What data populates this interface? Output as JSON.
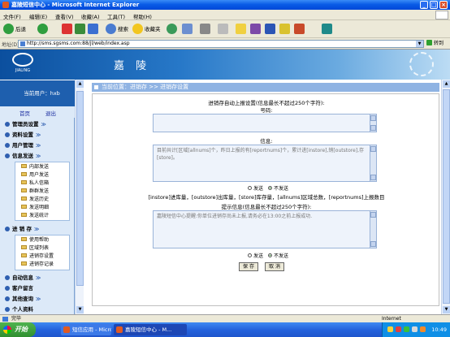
{
  "window": {
    "title": "嘉陵短信中心 - Microsoft Internet Explorer",
    "buttons": [
      "_",
      "□",
      "×"
    ]
  },
  "menubar": [
    "文件(F)",
    "编辑(E)",
    "查看(V)",
    "收藏(A)",
    "工具(T)",
    "帮助(H)"
  ],
  "toolbar": {
    "back_label": "后退",
    "search_label": "搜索",
    "favorites_label": "收藏夹"
  },
  "address": {
    "label": "地址(D)",
    "url": "http://sms.sgsms.com:88/jl/web/index.asp",
    "go_label": "转到"
  },
  "banner": {
    "logo_text": "JIALING",
    "title": "嘉 陵"
  },
  "sidebar": {
    "current_user": "当前用户：hxb",
    "home_link": "首页",
    "logout_link": "退出",
    "menu": [
      {
        "label": "管理员设置",
        "arrow": "≫"
      },
      {
        "label": "资料设置",
        "arrow": "≫"
      },
      {
        "label": "用户管理",
        "arrow": "≫"
      },
      {
        "label": "信息发送",
        "arrow": "≫"
      },
      {
        "label": "进 销 存",
        "arrow": "≫"
      },
      {
        "label": "自动信息",
        "arrow": "≫"
      },
      {
        "label": "客户留言",
        "arrow": ""
      },
      {
        "label": "其他查询",
        "arrow": "≫"
      },
      {
        "label": "个人资料",
        "arrow": ""
      }
    ],
    "sub_send": [
      "内部发送",
      "用户发送",
      "私人信箱",
      "群群发送",
      "发送历史",
      "发送明细",
      "发送统计"
    ],
    "sub_inventory": [
      "使用帮助",
      "区域列表",
      "进销存设置",
      "进销存记录"
    ]
  },
  "content": {
    "breadcrumb": "当前位置：进销存 >> 进销存设置",
    "auto_report_heading": "进销存自动上报设置(信息最长不超过250个字符):",
    "number_label": "号码:",
    "number_value": "",
    "info_label": "信息:",
    "info_value": "目前共计[区域[allnums]个，昨日上报的有[reportnums]个，累计进[instore],销[outstore],存[store]。",
    "radio_send": "发送",
    "radio_nosend": "不发送",
    "legend": "[instore]进库量，[outstore]出库量，[store]库存量，[allnums]区域总数，[reportnums]上报数目",
    "reminder_heading": "提示信息(信息最长不超过250个字符):",
    "reminder_value": "嘉陵短信中心提醒:你单位进销存尚未上报,请务必在13:00之前上报成功.",
    "save_button": "保 存",
    "cancel_button": "取 消"
  },
  "status": {
    "text": "完毕",
    "zone": "Internet"
  },
  "taskbar": {
    "start": "开始",
    "tasks": [
      "短信应用 - Micro...",
      "嘉陵短信中心 - M..."
    ],
    "clock": "10:49"
  }
}
